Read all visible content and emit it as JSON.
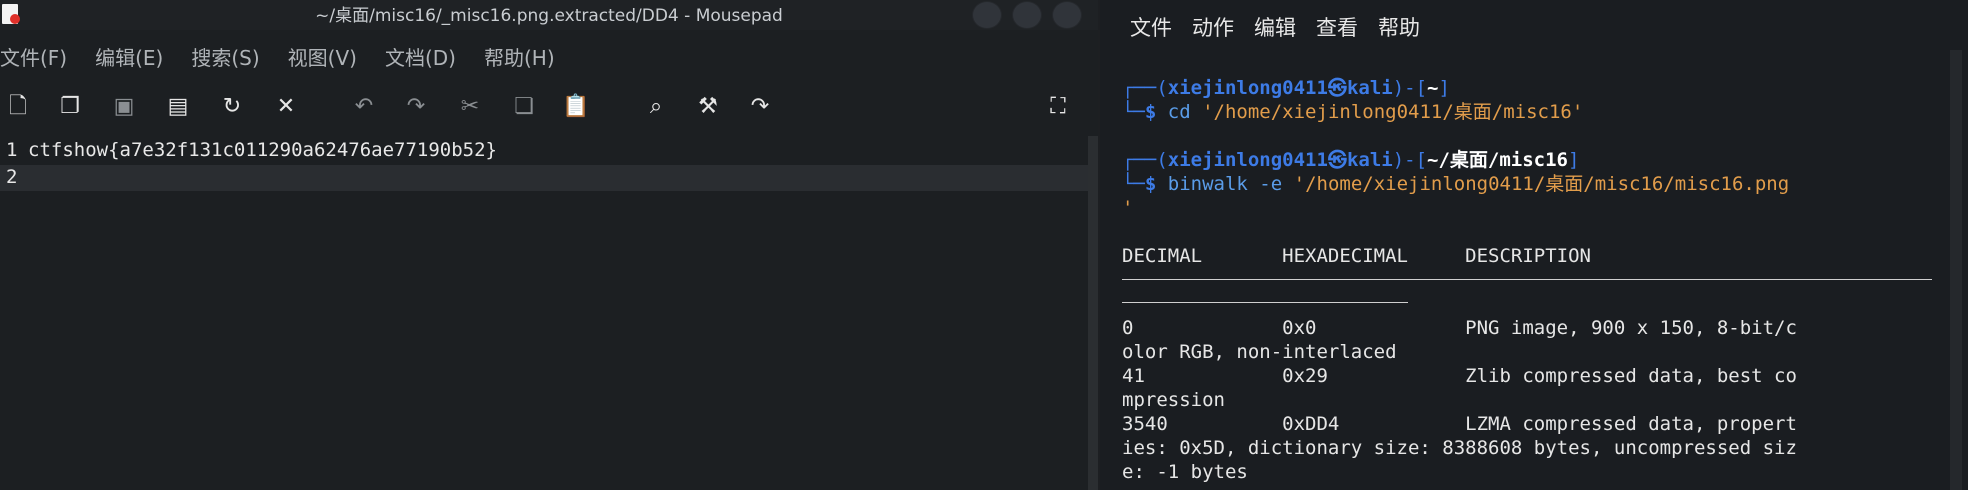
{
  "mousepad": {
    "title": "~/桌面/misc16/_misc16.png.extracted/DD4 - Mousepad",
    "menu": [
      "文件(F)",
      "编辑(E)",
      "搜索(S)",
      "视图(V)",
      "文档(D)",
      "帮助(H)"
    ],
    "toolbar": [
      "new-document-icon",
      "new-window-icon",
      "save-icon",
      "save-as-icon",
      "reload-icon",
      "close-icon",
      "undo-icon",
      "redo-icon",
      "cut-icon",
      "copy-icon",
      "paste-icon",
      "search-icon",
      "replace-icon",
      "goto-icon",
      "fullscreen-icon"
    ],
    "lines": [
      {
        "num": "1",
        "text": "ctfshow{a7e32f131c011290a62476ae77190b52}"
      },
      {
        "num": "2",
        "text": ""
      }
    ]
  },
  "terminal": {
    "menu": [
      "文件",
      "动作",
      "编辑",
      "查看",
      "帮助"
    ],
    "prompt1": {
      "open": "┌──(",
      "user": "xiejinlong0411",
      "at": "㉿",
      "host": "kali",
      "mid": ")-[",
      "dir": "~",
      "close": "]"
    },
    "cmd1": {
      "prefix": "└─",
      "dollar": "$ ",
      "cmd": "cd ",
      "arg": "'/home/xiejinlong0411/桌面/misc16'"
    },
    "prompt2": {
      "open": "┌──(",
      "user": "xiejinlong0411",
      "at": "㉿",
      "host": "kali",
      "mid": ")-[",
      "dir": "~/桌面/misc16",
      "close": "]"
    },
    "cmd2": {
      "prefix": "└─",
      "dollar": "$ ",
      "cmd": "binwalk -e ",
      "arg": "'/home/xiejinlong0411/桌面/misc16/misc16.png",
      "arg_cont": "'"
    },
    "header": "DECIMAL       HEXADECIMAL     DESCRIPTION",
    "output": [
      "0             0x0             PNG image, 900 x 150, 8-bit/c",
      "olor RGB, non-interlaced",
      "41            0x29            Zlib compressed data, best co",
      "mpression",
      "3540          0xDD4           LZMA compressed data, propert",
      "ies: 0x5D, dictionary size: 8388608 bytes, uncompressed siz",
      "e: -1 bytes"
    ]
  }
}
